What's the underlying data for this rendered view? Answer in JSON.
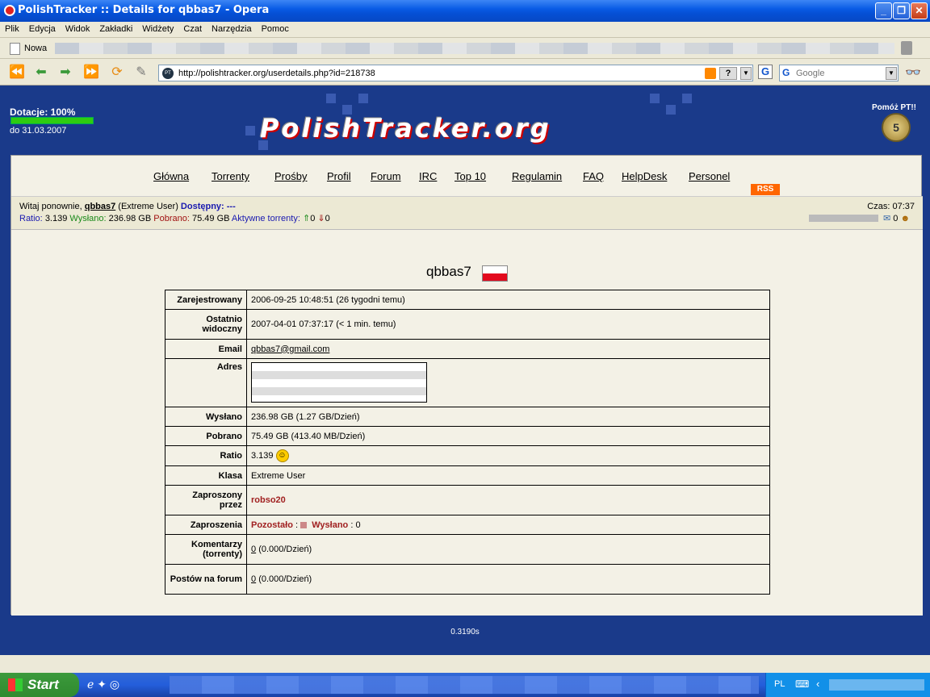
{
  "window": {
    "title": "PolishTracker :: Details for qbbas7 - Opera"
  },
  "menu": [
    "Plik",
    "Edycja",
    "Widok",
    "Zakładki",
    "Widżety",
    "Czat",
    "Narzędzia",
    "Pomoc"
  ],
  "tab": {
    "label": "Nowa"
  },
  "address": {
    "url": "http://polishtracker.org/userdetails.php?id=218738",
    "help": "?"
  },
  "search": {
    "placeholder": "Google",
    "engine": "G"
  },
  "header": {
    "donation": "Dotacje: 100%",
    "donation_progress": 1.0,
    "donation_until": "do 31.03.2007",
    "logo": "PolishTracker.org",
    "help_pt": "Pomóż PT!!",
    "coin": "5"
  },
  "nav": [
    "Główna",
    "Torrenty",
    "Prośby",
    "Profil",
    "Forum",
    "IRC",
    "Top 10",
    "Regulamin",
    "FAQ",
    "HelpDesk",
    "Personel"
  ],
  "nav_rss": "RSS",
  "userbar": {
    "welcome": "Witaj ponownie,",
    "user": "qbbas7",
    "class": "(Extreme User)",
    "available_label": "Dostępny:",
    "available_value": "---",
    "time": "Czas: 07:37",
    "ratio_label": "Ratio:",
    "ratio": "3.139",
    "uploaded_label": "Wysłano:",
    "uploaded": "236.98 GB",
    "downloaded_label": "Pobrano:",
    "downloaded": "75.49 GB",
    "active_label": "Aktywne torrenty:",
    "active_up": "0",
    "active_down": "0",
    "msg_count": "0"
  },
  "profile": {
    "username": "qbbas7",
    "rows": [
      {
        "label": "Zarejestrowany",
        "value": "2006-09-25 10:48:51 (26 tygodni temu)"
      },
      {
        "label": "Ostatnio widoczny",
        "value": "2007-04-01 07:37:17 (< 1 min. temu)"
      },
      {
        "label": "Email",
        "value": "qbbas7@gmail.com"
      },
      {
        "label": "Adres",
        "value": ""
      },
      {
        "label": "Wysłano",
        "value": "236.98 GB (1.27 GB/Dzień)"
      },
      {
        "label": "Pobrano",
        "value": "75.49 GB (413.40 MB/Dzień)"
      },
      {
        "label": "Ratio",
        "value": "3.139"
      },
      {
        "label": "Klasa",
        "value": "Extreme User"
      },
      {
        "label": "Zaproszony przez",
        "value": "robso20"
      },
      {
        "label": "Zaproszenia",
        "remaining_label": "Pozostało",
        "sent_label": "Wysłano",
        "sent": ": 0"
      },
      {
        "label": "Komentarzy (torrenty)",
        "count": "0",
        "rate": "(0.000/Dzień)"
      },
      {
        "label": "Postów na forum",
        "count": "0",
        "rate": "(0.000/Dzień)"
      }
    ]
  },
  "footer": {
    "gen_time": "0.3190s"
  },
  "taskbar": {
    "start": "Start",
    "lang": "PL"
  }
}
